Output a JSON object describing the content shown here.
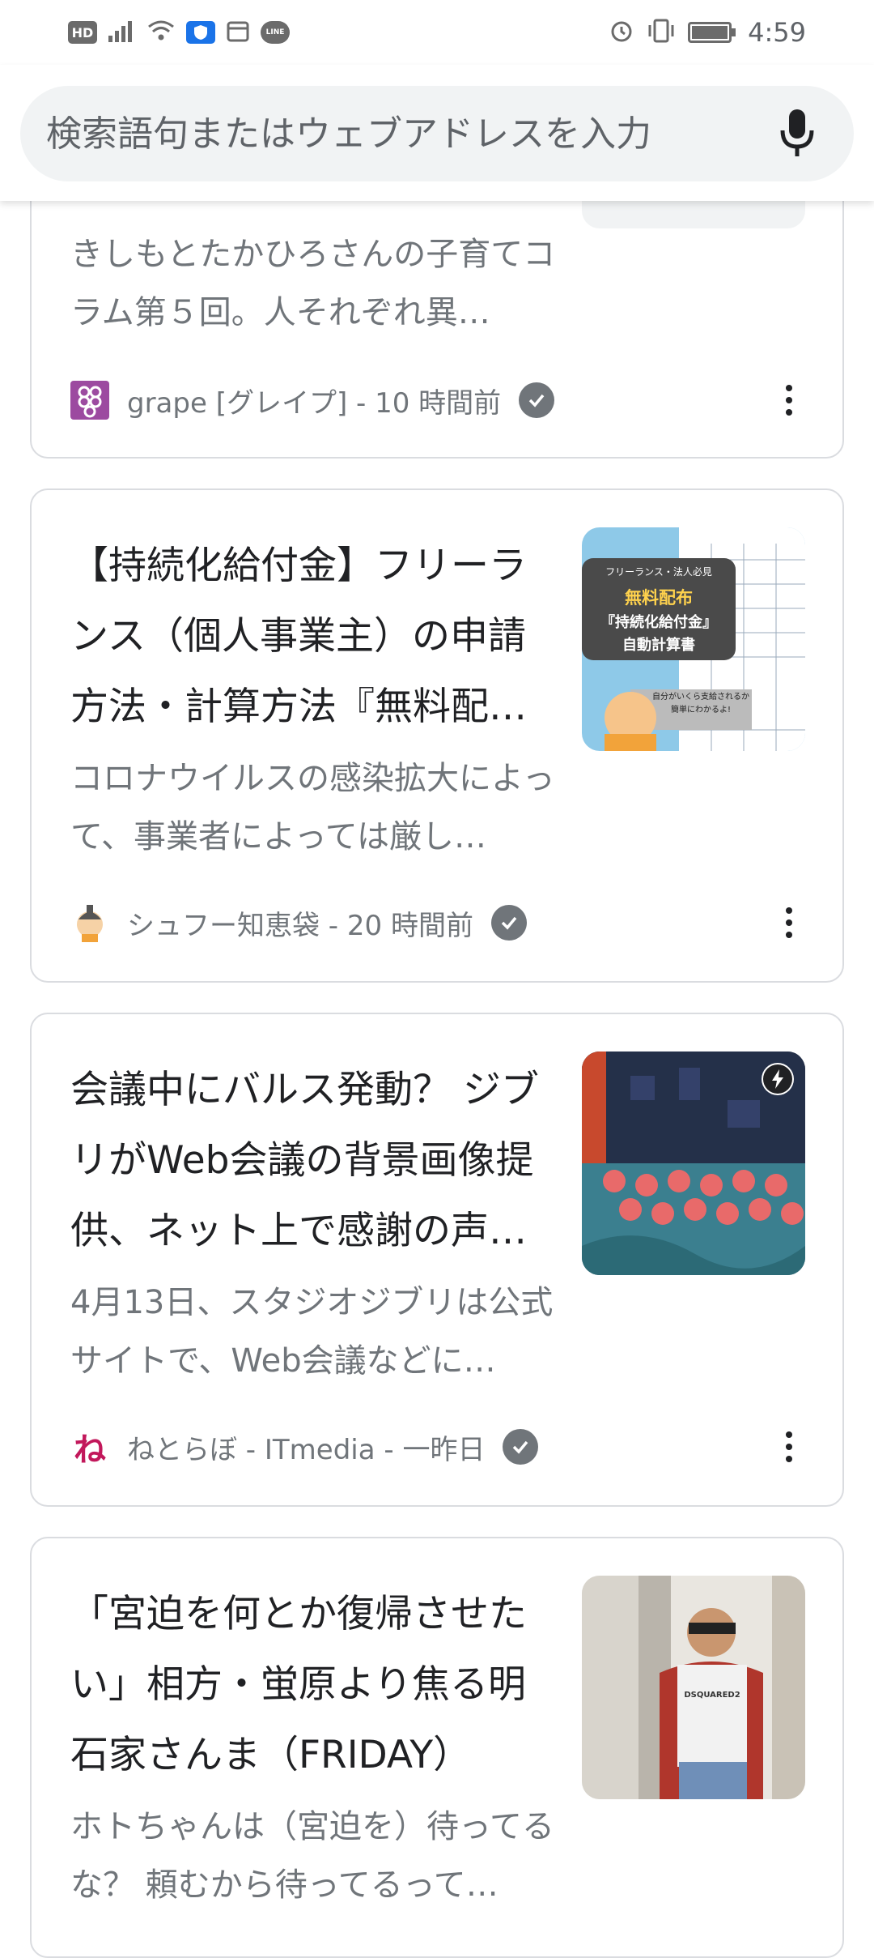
{
  "status_bar": {
    "left_badges": [
      "HD",
      "LINE"
    ],
    "time": "4:59"
  },
  "search": {
    "placeholder": "検索語句またはウェブアドレスを入力",
    "value": ""
  },
  "cards": [
    {
      "snippet": "きしもとたかひろさんの子育てコラム第５回。人それぞれ異…",
      "source": "grape [グレイプ] - 10 時間前",
      "source_icon": "grape-logo-icon"
    },
    {
      "title": "【持続化給付金】フリーランス（個人事業主）の申請方法・計算方法『無料配…",
      "snippet": "コロナウイルスの感染拡大によって、事業者によっては厳し…",
      "source": "シュフー知恵袋 - 20 時間前",
      "source_icon": "shufoo-logo-icon",
      "thumb_lines": [
        "フリーランス・法人必見",
        "無料配布",
        "『持続化給付金』",
        "自動計算書",
        "自分がいくら支給されるか",
        "簡単にわかるよ!"
      ]
    },
    {
      "title": "会議中にバルス発動？ ジブリがWeb会議の背景画像提供、ネット上で感謝の声…",
      "snippet": "4月13日、スタジオジブリは公式サイトで、Web会議などに…",
      "source": "ねとらぼ - ITmedia - 一昨日",
      "source_icon": "netorabo-logo-icon",
      "source_icon_char": "ね"
    },
    {
      "title": "「宮迫を何とか復帰させたい」相方・蛍原より焦る明石家さんま（FRIDAY）",
      "snippet": "ホトちゃんは（宮迫を）待ってるな？ 頼むから待ってるって…",
      "thumb_text": "DSQUARED2"
    }
  ]
}
